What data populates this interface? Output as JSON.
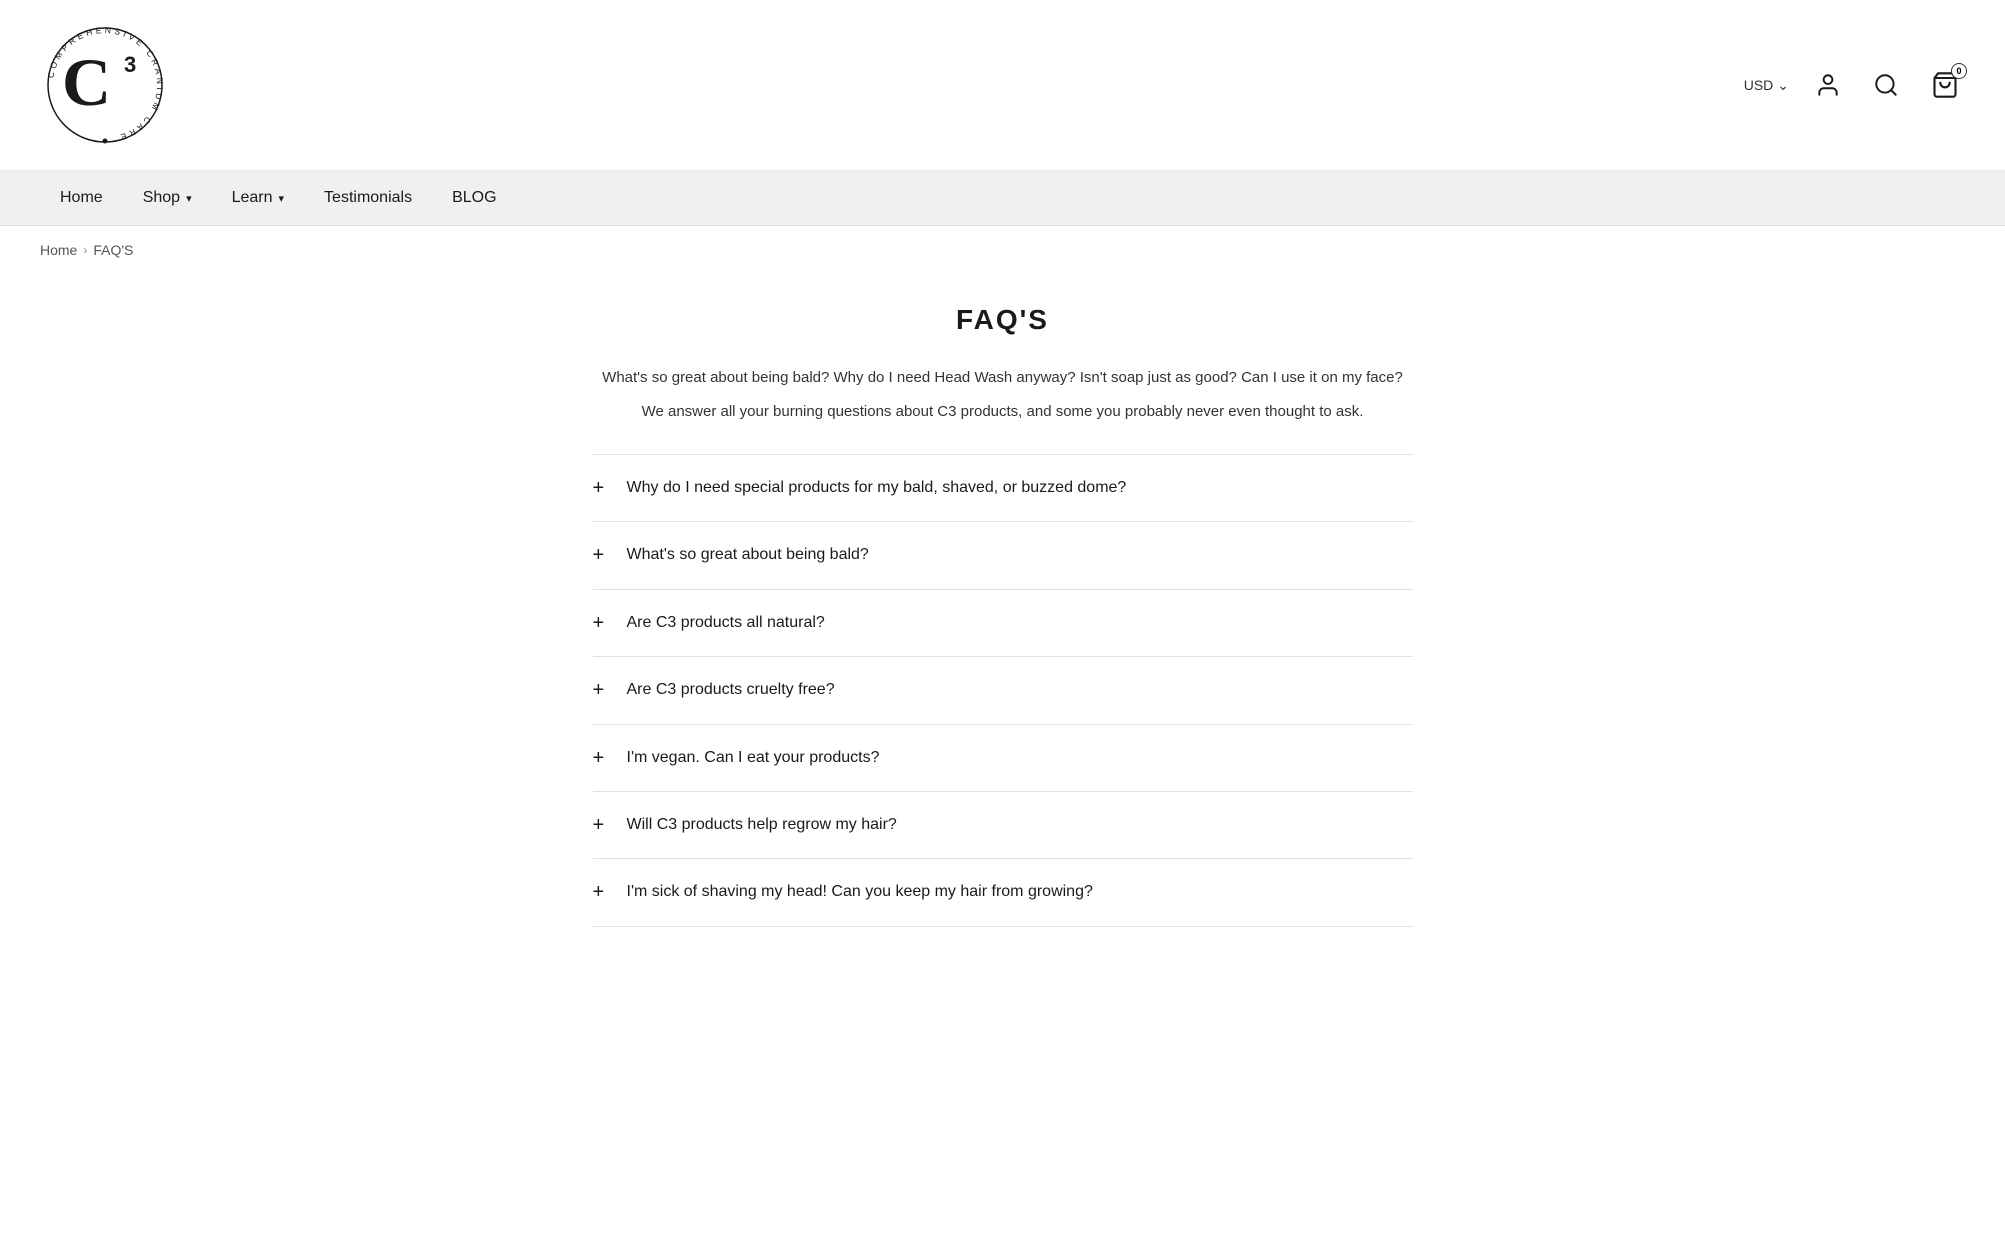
{
  "header": {
    "logo_alt": "C3 Comprehensive Cranium Care",
    "currency": "USD",
    "cart_count": "0"
  },
  "nav": {
    "items": [
      {
        "label": "Home",
        "has_dropdown": false
      },
      {
        "label": "Shop",
        "has_dropdown": true
      },
      {
        "label": "Learn",
        "has_dropdown": true
      },
      {
        "label": "Testimonials",
        "has_dropdown": false
      },
      {
        "label": "BLOG",
        "has_dropdown": false
      }
    ]
  },
  "breadcrumb": {
    "home_label": "Home",
    "separator": "›",
    "current": "FAQ'S"
  },
  "faq_page": {
    "title": "FAQ'S",
    "intro_line1": "What's so great about being bald? Why do I need Head Wash anyway? Isn't soap just as good? Can I use it on my face?",
    "intro_line2": "We answer all your burning questions about C3 products, and some you probably never even thought to ask.",
    "questions": [
      "Why do I need special products for my bald, shaved, or buzzed dome?",
      "What's so great about being bald?",
      "Are C3 products all natural?",
      "Are C3 products cruelty free?",
      "I'm vegan. Can I eat your products?",
      "Will C3 products help regrow my hair?",
      "I'm sick of shaving my head! Can you keep my hair from growing?"
    ]
  }
}
